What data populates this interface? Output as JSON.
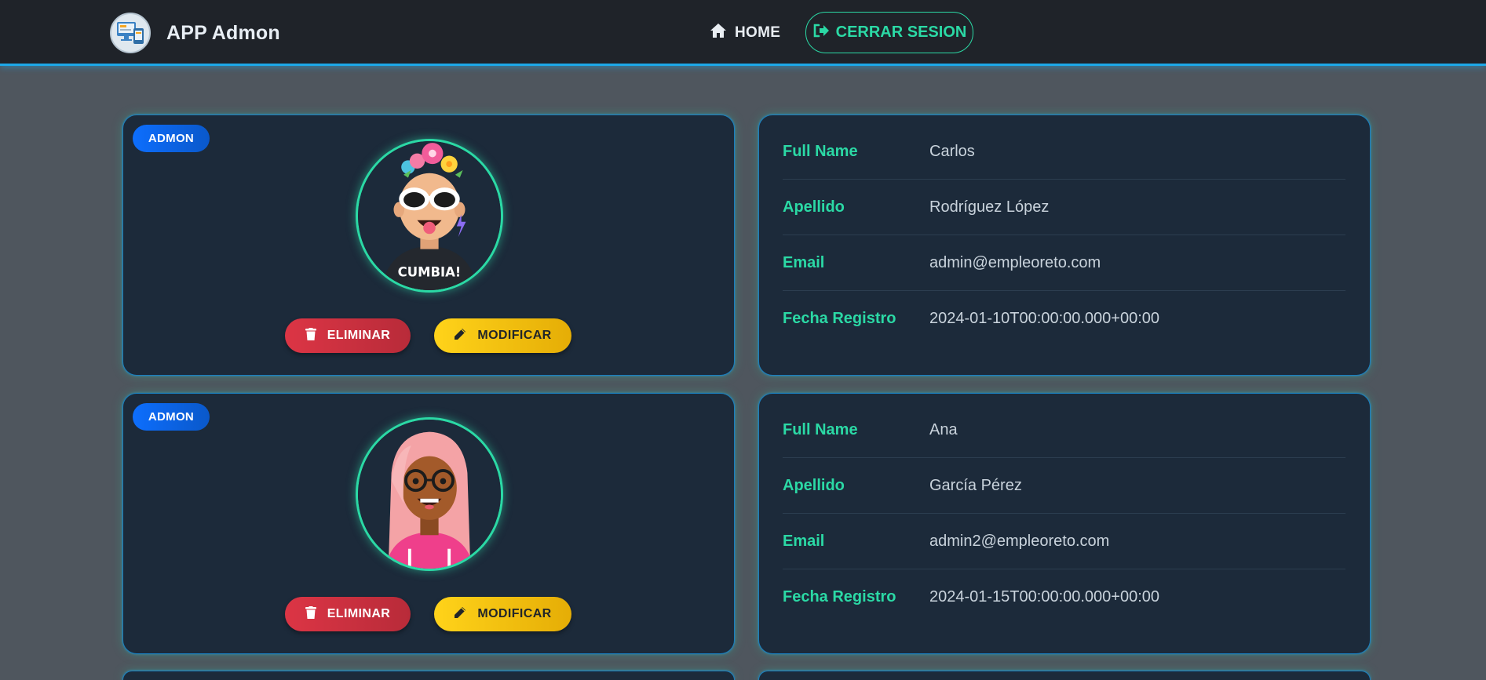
{
  "nav": {
    "brand": "APP Admon",
    "home_label": "HOME",
    "logout_label": "CERRAR SESION",
    "brand_icon": "app-logo-icon",
    "home_icon": "home-icon",
    "logout_icon": "sign-out-icon"
  },
  "colors": {
    "accent": "#2bd9a5",
    "primary": "#0d6efd",
    "danger": "#dc3545",
    "warning": "#ffc107",
    "card_bg": "#1c2a3a",
    "page_bg": "#4f565e"
  },
  "users": [
    {
      "badge": "ADMON",
      "delete_label": "ELIMINAR",
      "modify_label": "MODIFICAR",
      "fields": [
        {
          "label": "Full Name",
          "value": "Carlos"
        },
        {
          "label": "Apellido",
          "value": "Rodríguez López"
        },
        {
          "label": "Email",
          "value": "admin@empleoreto.com"
        },
        {
          "label": "Fecha Registro",
          "value": "2024-01-10T00:00:00.000+00:00"
        }
      ]
    },
    {
      "badge": "ADMON",
      "delete_label": "ELIMINAR",
      "modify_label": "MODIFICAR",
      "fields": [
        {
          "label": "Full Name",
          "value": "Ana"
        },
        {
          "label": "Apellido",
          "value": "García Pérez"
        },
        {
          "label": "Email",
          "value": "admin2@empleoreto.com"
        },
        {
          "label": "Fecha Registro",
          "value": "2024-01-15T00:00:00.000+00:00"
        }
      ]
    }
  ]
}
